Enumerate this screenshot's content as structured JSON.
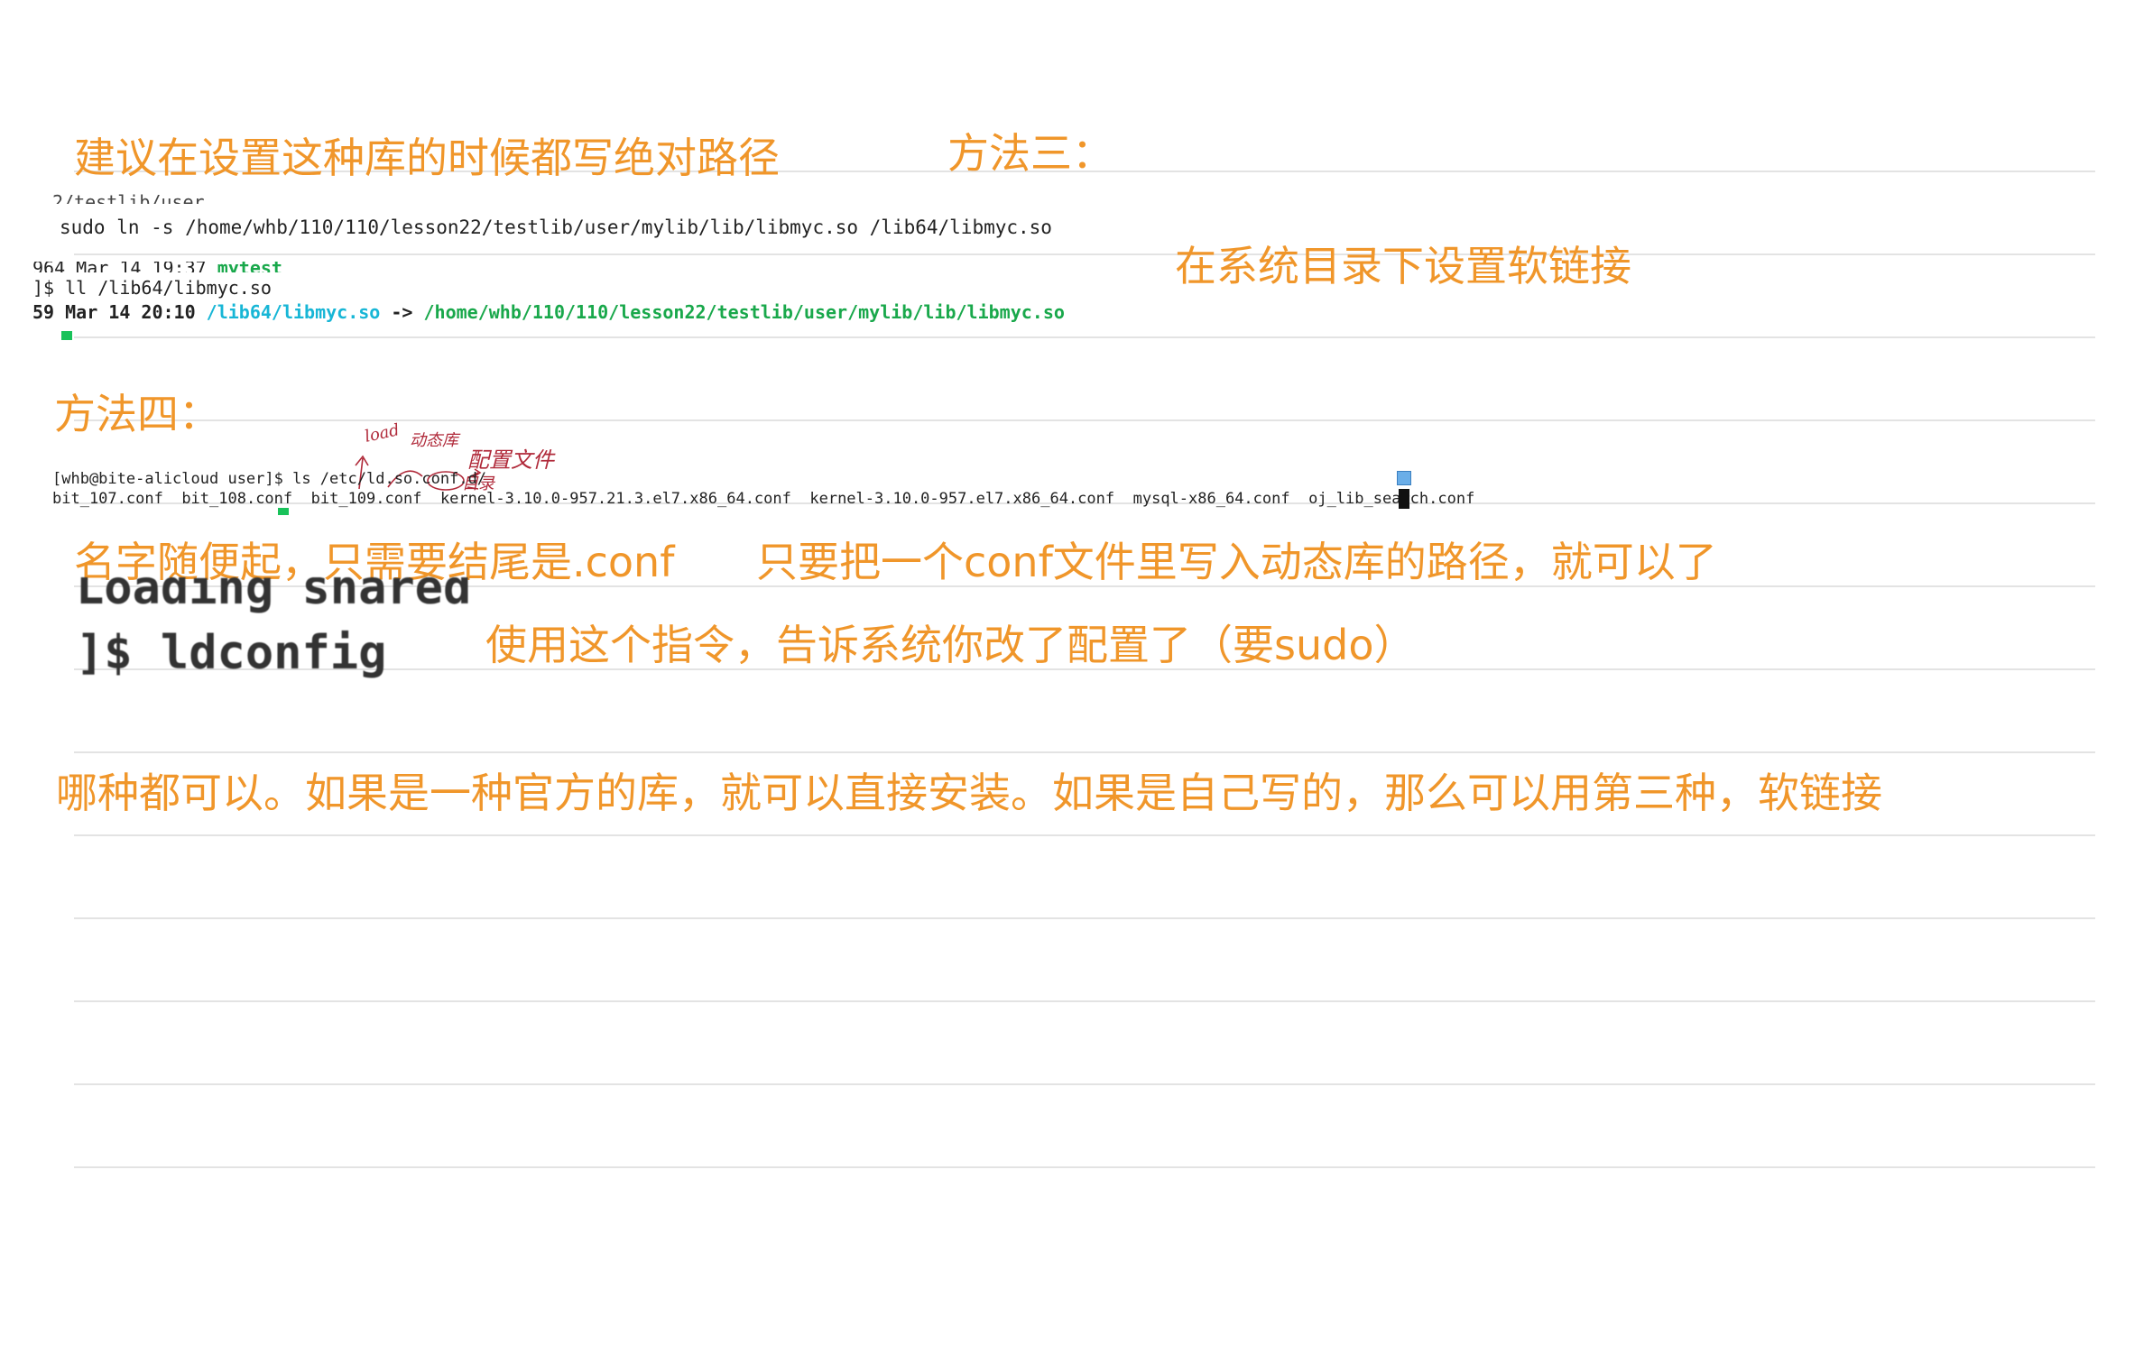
{
  "notes": {
    "suggest_absolute_path": "建议在设置这种库的时候都写绝对路径",
    "method_three": "方法三：",
    "method_three_desc": "在系统目录下设置软链接",
    "method_four": "方法四：",
    "name_any_conf": "名字随便起，只需要结尾是.conf",
    "write_path_conf": "只要把一个conf文件里写入动态库的路径，就可以了",
    "ldconfig_tip": "使用这个指令，告诉系统你改了配置了（要sudo）",
    "summary": "哪种都可以。如果是一种官方的库，就可以直接安装。如果是自己写的，那么可以用第三种，软链接"
  },
  "terminal_a": {
    "cropped_top": "2/testlib/user",
    "command": "sudo ln -s /home/whb/110/110/lesson22/testlib/user/mylib/lib/libmyc.so /lib64/libmyc.so"
  },
  "terminal_b": {
    "line1_prefix": "964 Mar 14 19:37 ",
    "line1_name": "mytest",
    "line2": "]$ ll /lib64/libmyc.so",
    "line3_prefix": "59 Mar 14 20:10 ",
    "line3_link": "/lib64/libmyc.so",
    "line3_arrow": " -> ",
    "line3_target": "/home/whb/110/110/lesson22/testlib/user/mylib/lib/libmyc.so"
  },
  "terminal_c": {
    "prompt_line": "[whb@bite-alicloud user]$ ls /etc/ld.so.conf.d/",
    "files": [
      "bit_107.conf",
      "bit_108.conf",
      "bit_109.conf",
      "kernel-3.10.0-957.21.3.el7.x86_64.conf",
      "kernel-3.10.0-957.el7.x86_64.conf",
      "mysql-x86_64.conf",
      "oj_lib_search.conf"
    ]
  },
  "handwriting": {
    "load": "load",
    "dynamic_lib": "动态库",
    "config_file": "配置文件",
    "directory": "目录"
  },
  "terminal_d": {
    "cropped_top": "Loading shared",
    "command": "]$ ldconfig"
  },
  "colors": {
    "note_orange": "#f0962a",
    "ruled_line": "#e3e3e3",
    "terminal_cyan": "#17b6d6",
    "terminal_green": "#19a84b",
    "handwriting_red": "#b02a3a"
  }
}
